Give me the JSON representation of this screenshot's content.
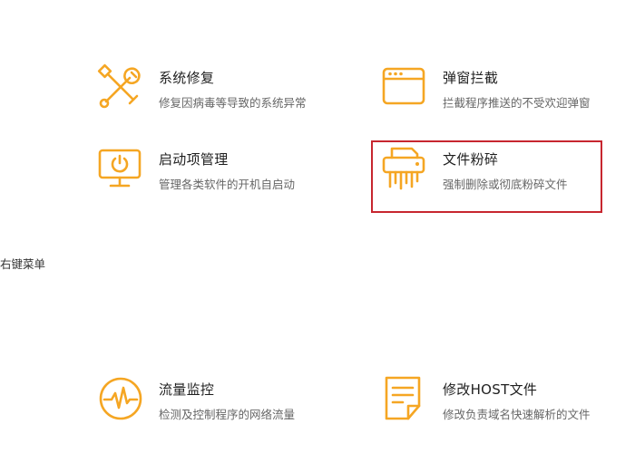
{
  "colors": {
    "accent": "#f5a623",
    "highlight": "#c7262f"
  },
  "tools": {
    "system_repair": {
      "title": "系统修复",
      "desc": "修复因病毒等导致的系统异常",
      "icon": "wrench-screwdriver-icon"
    },
    "popup_block": {
      "title": "弹窗拦截",
      "desc": "拦截程序推送的不受欢迎弹窗",
      "icon": "window-icon"
    },
    "startup_manager": {
      "title": "启动项管理",
      "desc": "管理各类软件的开机自启动",
      "icon": "monitor-power-icon"
    },
    "file_shredder": {
      "title": "文件粉碎",
      "desc": "强制删除或彻底粉碎文件",
      "icon": "shredder-icon",
      "highlighted": true
    },
    "traffic_monitor": {
      "title": "流量监控",
      "desc": "检测及控制程序的网络流量",
      "icon": "pulse-monitor-icon"
    },
    "host_edit": {
      "title": "修改HOST文件",
      "desc": "修改负责域名快速解析的文件",
      "icon": "document-icon"
    }
  },
  "side": {
    "context_menu_label": "右键菜单"
  }
}
